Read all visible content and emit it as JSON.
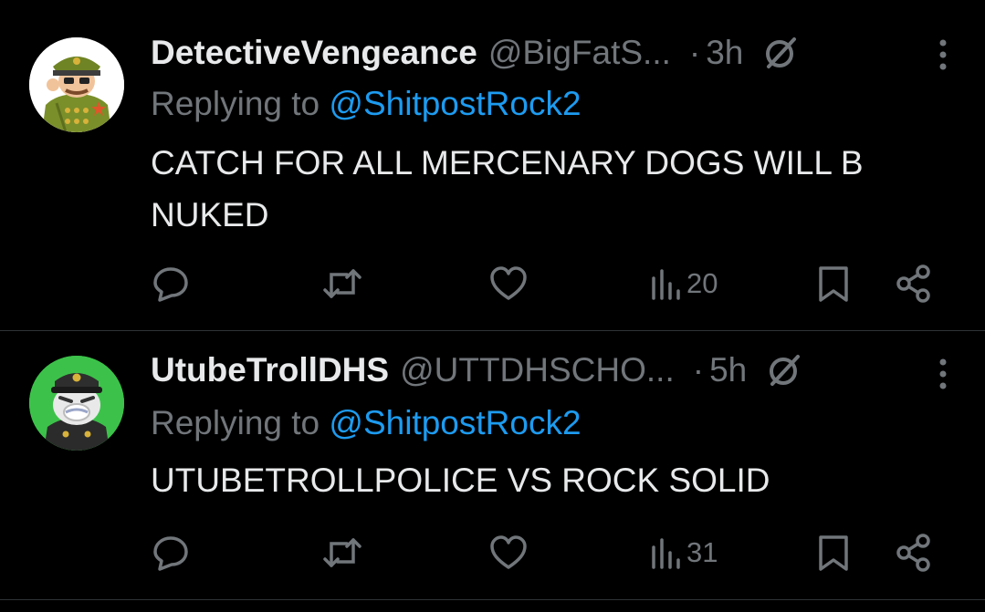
{
  "tweets": [
    {
      "display_name": "DetectiveVengeance",
      "handle": "@BigFatS...",
      "separator": "·",
      "time": "3h",
      "replying_label": "Replying to",
      "replying_to": "@ShitpostRock2",
      "text": "CATCH FOR ALL MERCENARY DOGS WILL B NUKED",
      "views": "20",
      "icons": {
        "grok": "grok-slash-icon",
        "more": "more-vertical-icon",
        "reply": "reply-bubble-icon",
        "repost": "repost-arrows-icon",
        "like": "heart-icon",
        "views": "bar-chart-icon",
        "bookmark": "bookmark-icon",
        "share": "share-icon"
      }
    },
    {
      "display_name": "UtubeTrollDHS",
      "handle": "@UTTDHSCHO...",
      "separator": "·",
      "time": "5h",
      "replying_label": "Replying to",
      "replying_to": "@ShitpostRock2",
      "text": "UTUBETROLLPOLICE VS ROCK SOLID",
      "views": "31",
      "icons": {
        "grok": "grok-slash-icon",
        "more": "more-vertical-icon",
        "reply": "reply-bubble-icon",
        "repost": "repost-arrows-icon",
        "like": "heart-icon",
        "views": "bar-chart-icon",
        "bookmark": "bookmark-icon",
        "share": "share-icon"
      }
    }
  ],
  "colors": {
    "background": "#000000",
    "text_primary": "#e7e9ea",
    "text_secondary": "#71767b",
    "mention": "#1d9bf0",
    "divider": "#2f3336",
    "avatar_2_bg": "#3cc24a"
  }
}
